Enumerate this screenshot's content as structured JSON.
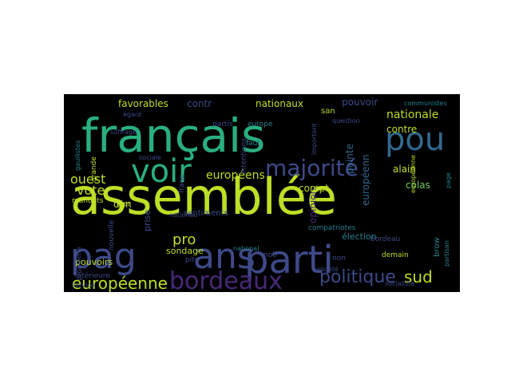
{
  "wordcloud": {
    "background": "#000000",
    "palette": {
      "yellow": "#bddf26",
      "teal": "#29af7f",
      "indigo": "#3e4a89",
      "purple": "#482878",
      "blue": "#31688e",
      "cyan": "#26828e",
      "green": "#6ece58",
      "lime": "#b5de2b"
    },
    "words": [
      {
        "text": "assemblée",
        "color": "#bddf26"
      },
      {
        "text": "français",
        "color": "#29af7f"
      },
      {
        "text": "parti",
        "color": "#3e4a89"
      },
      {
        "text": "ans",
        "color": "#3e4a89"
      },
      {
        "text": "pag",
        "color": "#3e4a89"
      },
      {
        "text": "pou",
        "color": "#31688e"
      },
      {
        "text": "voir",
        "color": "#29af7f"
      },
      {
        "text": "bordeaux",
        "color": "#482878"
      },
      {
        "text": "majorité",
        "color": "#3e4a89"
      },
      {
        "text": "politique",
        "color": "#3e4a89"
      },
      {
        "text": "européenne",
        "color": "#bddf26"
      },
      {
        "text": "sud",
        "color": "#bddf26"
      },
      {
        "text": "nationale",
        "color": "#bddf26"
      },
      {
        "text": "ouest",
        "color": "#bddf26"
      },
      {
        "text": "européens",
        "color": "#bddf26"
      },
      {
        "text": "vote",
        "color": "#bddf26"
      },
      {
        "text": "pro",
        "color": "#bddf26"
      },
      {
        "text": "favorables",
        "color": "#bddf26"
      },
      {
        "text": "nationaux",
        "color": "#bddf26"
      },
      {
        "text": "contr",
        "color": "#3e4a89"
      },
      {
        "text": "pouvoir",
        "color": "#3e4a89"
      },
      {
        "text": "opinion",
        "color": "#482878"
      },
      {
        "text": "européenn",
        "color": "#31688e"
      },
      {
        "text": "alain",
        "color": "#bddf26"
      },
      {
        "text": "colas",
        "color": "#6ece58"
      },
      {
        "text": "contre",
        "color": "#bddf26"
      },
      {
        "text": "compt",
        "color": "#bddf26"
      },
      {
        "text": "pointe",
        "color": "#31688e"
      },
      {
        "text": "dan",
        "color": "#bddf26"
      },
      {
        "text": "prise",
        "color": "#3e4a89"
      },
      {
        "text": "sondage",
        "color": "#bddf26"
      },
      {
        "text": "pouvoirs",
        "color": "#bddf26"
      },
      {
        "text": "sentiments",
        "color": "#3e4a89"
      },
      {
        "text": "élection",
        "color": "#26828e"
      },
      {
        "text": "compatriotes",
        "color": "#26828e"
      },
      {
        "text": "demain",
        "color": "#bddf26"
      },
      {
        "text": "san",
        "color": "#b5de2b"
      },
      {
        "text": "communistes",
        "color": "#26828e"
      },
      {
        "text": "brow",
        "color": "#26828e"
      },
      {
        "text": "intérieure",
        "color": "#3e4a89"
      },
      {
        "text": "mandats",
        "color": "#bddf26"
      },
      {
        "text": "nouvelle",
        "color": "#3e4a89"
      },
      {
        "text": "problème",
        "color": "#3e4a89"
      },
      {
        "text": "hier",
        "color": "#bddf26"
      },
      {
        "text": "franc",
        "color": "#3e4a89"
      },
      {
        "text": "faut",
        "color": "#26828e"
      },
      {
        "text": "europe",
        "color": "#26828e"
      },
      {
        "text": "gaullistes",
        "color": "#26828e"
      },
      {
        "text": "pitr",
        "color": "#3e4a89"
      },
      {
        "text": "notr",
        "color": "#3e4a89"
      },
      {
        "text": "important",
        "color": "#3e4a89"
      },
      {
        "text": "européenne",
        "color": "#bddf26"
      },
      {
        "text": "grande",
        "color": "#bddf26"
      },
      {
        "text": "suffrage",
        "color": "#3e4a89"
      },
      {
        "text": "national",
        "color": "#26828e"
      },
      {
        "text": "non",
        "color": "#3e4a89"
      },
      {
        "text": "partisan",
        "color": "#26828e"
      },
      {
        "text": "page",
        "color": "#26828e"
      },
      {
        "text": "bordeau",
        "color": "#3e4a89"
      },
      {
        "text": "question",
        "color": "#3e4a89"
      },
      {
        "text": "nationau",
        "color": "#3e4a89"
      },
      {
        "text": "égard",
        "color": "#3e4a89"
      },
      {
        "text": "sociale",
        "color": "#3e4a89"
      },
      {
        "text": "volonté",
        "color": "#3e4a89"
      },
      {
        "text": "service",
        "color": "#3e4a89"
      },
      {
        "text": "socialiste",
        "color": "#3e4a89"
      },
      {
        "text": "intentions",
        "color": "#3e4a89"
      },
      {
        "text": "partis",
        "color": "#3e4a89"
      }
    ]
  }
}
